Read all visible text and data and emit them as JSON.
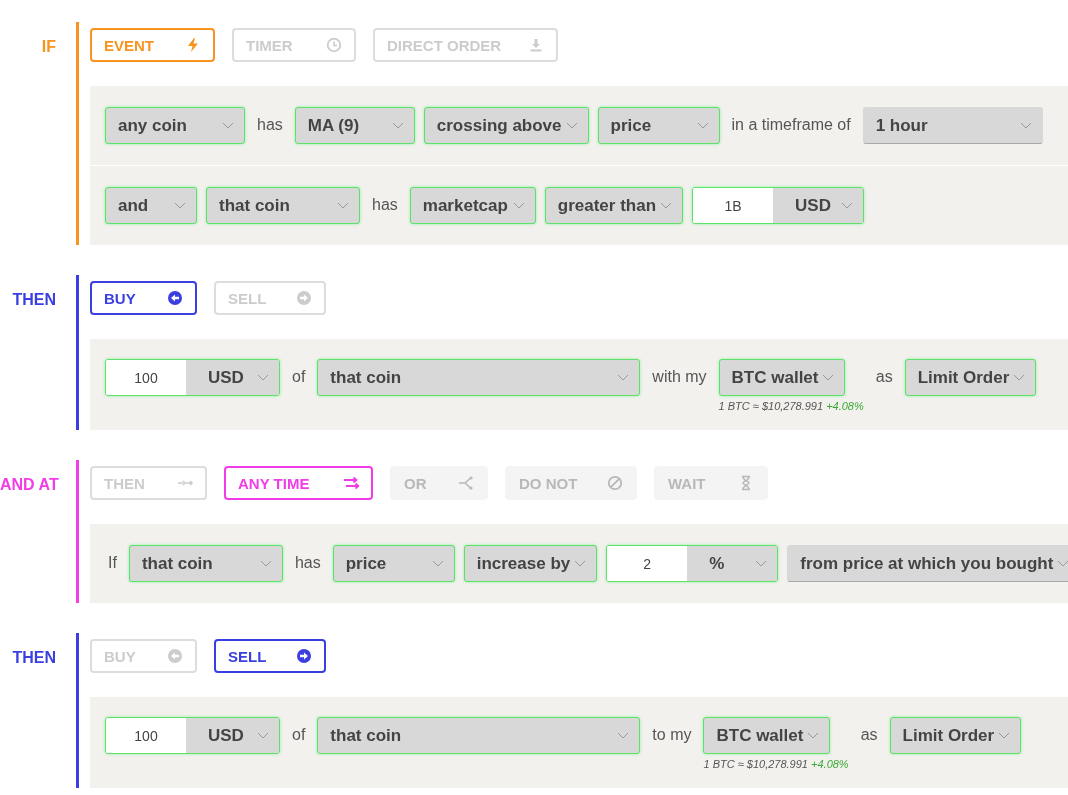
{
  "sections": [
    {
      "label": "IF",
      "color": "#f7931e",
      "tabs": [
        {
          "label": "EVENT",
          "selected": true,
          "disabled": false
        },
        {
          "label": "TIMER",
          "selected": false,
          "disabled": false
        },
        {
          "label": "DIRECT ORDER",
          "selected": false,
          "disabled": false
        }
      ],
      "rows": [
        {
          "items": [
            {
              "kind": "select",
              "value": "any coin",
              "valid": true
            },
            {
              "kind": "word",
              "text": "has"
            },
            {
              "kind": "select",
              "value": "MA (9)",
              "valid": true
            },
            {
              "kind": "select",
              "value": "crossing above",
              "valid": true
            },
            {
              "kind": "select",
              "value": "price",
              "valid": true
            },
            {
              "kind": "word",
              "text": "in a timeframe of"
            },
            {
              "kind": "select",
              "value": "1 hour",
              "valid": false
            }
          ]
        },
        {
          "items": [
            {
              "kind": "select",
              "value": "and",
              "valid": true
            },
            {
              "kind": "select",
              "value": "that coin",
              "valid": true
            },
            {
              "kind": "word",
              "text": "has"
            },
            {
              "kind": "select",
              "value": "marketcap",
              "valid": true
            },
            {
              "kind": "select",
              "value": "greater than",
              "valid": true
            },
            {
              "kind": "amount",
              "value": "1B",
              "unit": "USD",
              "valid": true
            }
          ]
        }
      ]
    },
    {
      "label": "THEN",
      "color": "#3b3fe0",
      "tabs": [
        {
          "label": "BUY",
          "selected": true,
          "disabled": false
        },
        {
          "label": "SELL",
          "selected": false,
          "disabled": false
        }
      ],
      "rows": [
        {
          "items": [
            {
              "kind": "amount",
              "value": "100",
              "unit": "USD",
              "valid": true
            },
            {
              "kind": "word",
              "text": "of"
            },
            {
              "kind": "select",
              "value": "that coin",
              "valid": true
            },
            {
              "kind": "word",
              "text": "with my"
            },
            {
              "kind": "wallet",
              "value": "BTC wallet",
              "valid": true,
              "note": "1 BTC ≈ $10,278.991",
              "change": "+4.08%"
            },
            {
              "kind": "word",
              "text": "as"
            },
            {
              "kind": "select",
              "value": "Limit Order",
              "valid": true
            }
          ]
        }
      ]
    },
    {
      "label": "AND AT",
      "color": "#f23ce8",
      "tabs": [
        {
          "label": "THEN",
          "selected": false,
          "disabled": false
        },
        {
          "label": "ANY TIME",
          "selected": true,
          "disabled": false
        },
        {
          "label": "OR",
          "selected": false,
          "disabled": true
        },
        {
          "label": "DO NOT",
          "selected": false,
          "disabled": true
        },
        {
          "label": "WAIT",
          "selected": false,
          "disabled": true
        }
      ],
      "rows": [
        {
          "items": [
            {
              "kind": "word",
              "text": "If"
            },
            {
              "kind": "select",
              "value": "that coin",
              "valid": true
            },
            {
              "kind": "word",
              "text": "has"
            },
            {
              "kind": "select",
              "value": "price",
              "valid": true
            },
            {
              "kind": "select",
              "value": "increase by",
              "valid": true
            },
            {
              "kind": "amount",
              "value": "2",
              "unit": "%",
              "valid": true
            },
            {
              "kind": "select",
              "value": "from price at which you bought",
              "valid": false
            }
          ]
        }
      ]
    },
    {
      "label": "THEN",
      "color": "#3b3fe0",
      "tabs": [
        {
          "label": "BUY",
          "selected": false,
          "disabled": false
        },
        {
          "label": "SELL",
          "selected": true,
          "disabled": false
        }
      ],
      "rows": [
        {
          "items": [
            {
              "kind": "amount",
              "value": "100",
              "unit": "USD",
              "valid": true
            },
            {
              "kind": "word",
              "text": "of"
            },
            {
              "kind": "select",
              "value": "that coin",
              "valid": true
            },
            {
              "kind": "word",
              "text": "to my"
            },
            {
              "kind": "wallet",
              "value": "BTC wallet",
              "valid": true,
              "note": "1 BTC ≈ $10,278.991",
              "change": "+4.08%"
            },
            {
              "kind": "word",
              "text": "as"
            },
            {
              "kind": "select",
              "value": "Limit Order",
              "valid": true
            }
          ]
        }
      ]
    }
  ]
}
